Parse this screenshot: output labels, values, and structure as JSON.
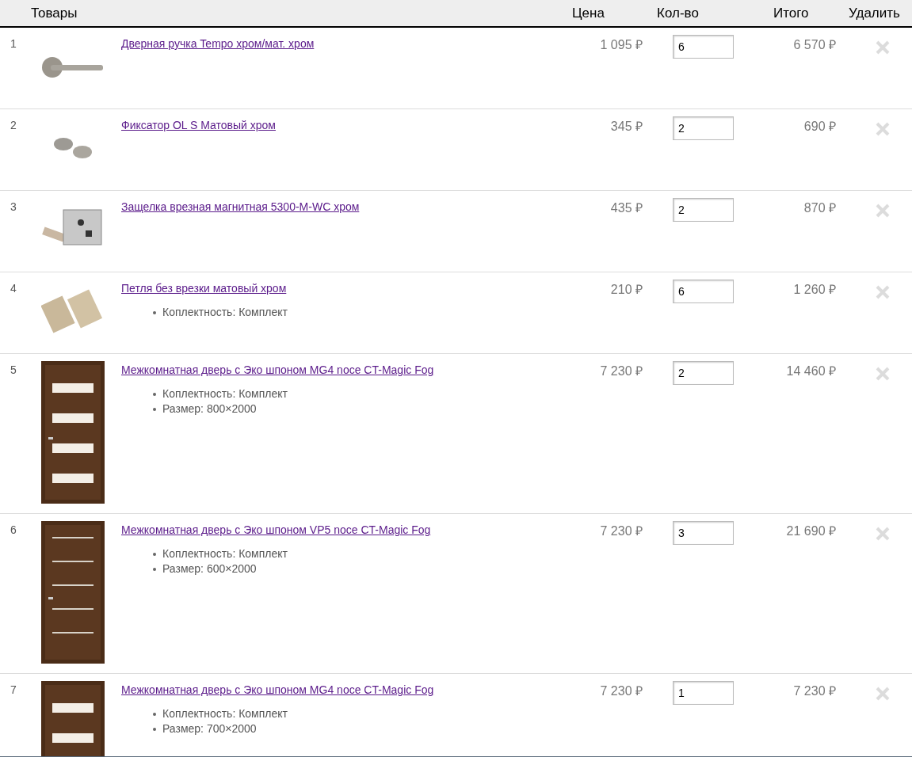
{
  "table": {
    "columns": [
      "Товары",
      "Цена",
      "Кол-во",
      "Итого",
      "Удалить"
    ],
    "rows": [
      {
        "number": "1",
        "kind": "handle",
        "name": "Дверная ручка Tempo хром/мат. хром",
        "options": [],
        "price": "1 095 ₽",
        "quantity": "6",
        "total": "6 570 ₽"
      },
      {
        "number": "2",
        "kind": "latch",
        "name": "Фиксатор OL S Матовый хром",
        "options": [],
        "price": "345 ₽",
        "quantity": "2",
        "total": "690 ₽"
      },
      {
        "number": "3",
        "kind": "lock",
        "name": "Защелка врезная магнитная 5300-M-WC хром",
        "options": [],
        "price": "435 ₽",
        "quantity": "2",
        "total": "870 ₽"
      },
      {
        "number": "4",
        "kind": "hinge",
        "name": "Петля без врезки матовый хром",
        "options": [
          "Коплектность: Комплект"
        ],
        "price": "210 ₽",
        "quantity": "6",
        "total": "1 260 ₽"
      },
      {
        "number": "5",
        "kind": "door-glass",
        "name": "Межкомнатная дверь с Эко шпоном MG4 noce CT-Magic Fog",
        "options": [
          "Коплектность: Комплект",
          "Размер: 800×2000"
        ],
        "price": "7 230 ₽",
        "quantity": "2",
        "total": "14 460 ₽"
      },
      {
        "number": "6",
        "kind": "door-strips",
        "name": "Межкомнатная дверь с Эко шпоном VP5 noce CT-Magic Fog",
        "options": [
          "Коплектность: Комплект",
          "Размер: 600×2000"
        ],
        "price": "7 230 ₽",
        "quantity": "3",
        "total": "21 690 ₽"
      },
      {
        "number": "7",
        "kind": "door-glass",
        "name": "Межкомнатная дверь с Эко шпоном MG4 noce CT-Magic Fog",
        "options": [
          "Коплектность: Комплект",
          "Размер: 700×2000"
        ],
        "price": "7 230 ₽",
        "quantity": "1",
        "total": "7 230 ₽"
      }
    ]
  }
}
